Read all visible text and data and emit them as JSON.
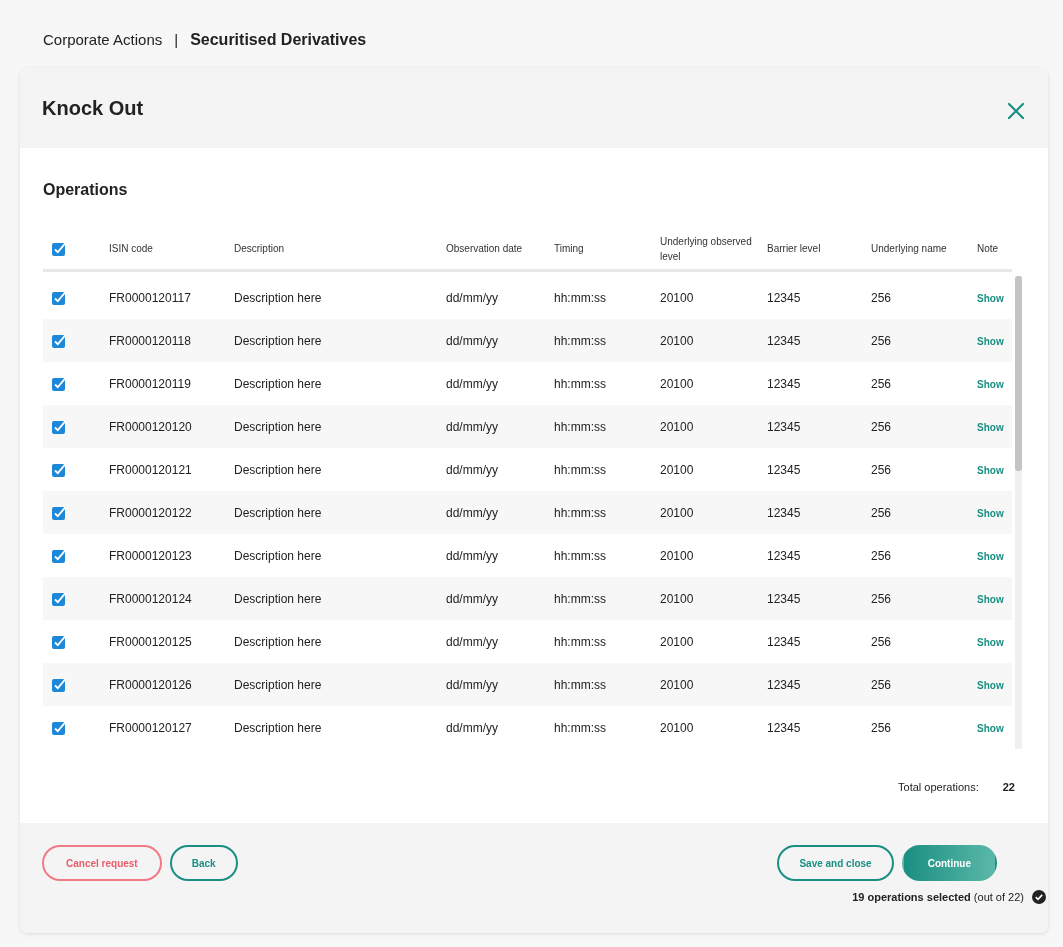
{
  "breadcrumb": [
    {
      "label": "Corporate Actions",
      "current": false
    },
    {
      "label": "Securitised Derivatives",
      "current": true
    }
  ],
  "breadcrumb_separator": "|",
  "dialog": {
    "title": "Knock Out"
  },
  "section_title": "Operations",
  "table": {
    "all_checked": true,
    "columns": [
      "ISIN code",
      "Description",
      "Observation date",
      "Timing",
      "Underlying observed level",
      "Barrier level",
      "Underlying name",
      "Note"
    ],
    "rows": [
      {
        "checked": true,
        "cells": [
          "FR0000120117",
          "Description here",
          "dd/mm/yy",
          "hh:mm:ss",
          "20100",
          "12345",
          "256"
        ],
        "note": "Show"
      },
      {
        "checked": true,
        "cells": [
          "FR0000120118",
          "Description here",
          "dd/mm/yy",
          "hh:mm:ss",
          "20100",
          "12345",
          "256"
        ],
        "note": "Show"
      },
      {
        "checked": true,
        "cells": [
          "FR0000120119",
          "Description here",
          "dd/mm/yy",
          "hh:mm:ss",
          "20100",
          "12345",
          "256"
        ],
        "note": "Show"
      },
      {
        "checked": true,
        "cells": [
          "FR0000120120",
          "Description here",
          "dd/mm/yy",
          "hh:mm:ss",
          "20100",
          "12345",
          "256"
        ],
        "note": "Show"
      },
      {
        "checked": true,
        "cells": [
          "FR0000120121",
          "Description here",
          "dd/mm/yy",
          "hh:mm:ss",
          "20100",
          "12345",
          "256"
        ],
        "note": "Show"
      },
      {
        "checked": true,
        "cells": [
          "FR0000120122",
          "Description here",
          "dd/mm/yy",
          "hh:mm:ss",
          "20100",
          "12345",
          "256"
        ],
        "note": "Show"
      },
      {
        "checked": true,
        "cells": [
          "FR0000120123",
          "Description here",
          "dd/mm/yy",
          "hh:mm:ss",
          "20100",
          "12345",
          "256"
        ],
        "note": "Show"
      },
      {
        "checked": true,
        "cells": [
          "FR0000120124",
          "Description here",
          "dd/mm/yy",
          "hh:mm:ss",
          "20100",
          "12345",
          "256"
        ],
        "note": "Show"
      },
      {
        "checked": true,
        "cells": [
          "FR0000120125",
          "Description here",
          "dd/mm/yy",
          "hh:mm:ss",
          "20100",
          "12345",
          "256"
        ],
        "note": "Show"
      },
      {
        "checked": true,
        "cells": [
          "FR0000120126",
          "Description here",
          "dd/mm/yy",
          "hh:mm:ss",
          "20100",
          "12345",
          "256"
        ],
        "note": "Show"
      },
      {
        "checked": true,
        "cells": [
          "FR0000120127",
          "Description here",
          "dd/mm/yy",
          "hh:mm:ss",
          "20100",
          "12345",
          "256"
        ],
        "note": "Show"
      }
    ]
  },
  "total": {
    "label": "Total operations:",
    "value": "22"
  },
  "footer": {
    "left_buttons": [
      {
        "label": "Cancel request",
        "kind": "danger"
      },
      {
        "label": "Back",
        "kind": "outline"
      }
    ],
    "right_buttons": [
      {
        "label": "Save and close",
        "kind": "outline"
      },
      {
        "label": "Continue",
        "kind": "primary"
      }
    ],
    "selection_summary": "**19 operations selected** (out of 22)"
  }
}
